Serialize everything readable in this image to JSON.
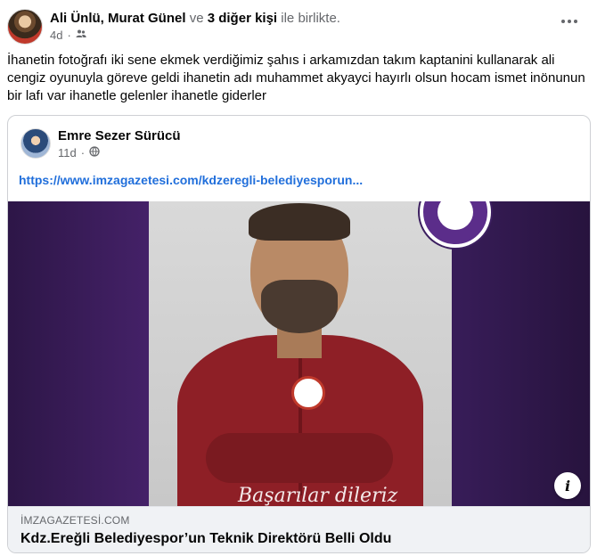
{
  "post": {
    "author1": "Ali Ünlü",
    "separator": ",",
    "author2": "Murat Günel",
    "and_word": "ve",
    "others": "3 diğer kişi",
    "with_text": "ile birlikte.",
    "time": "4d",
    "dot": "·",
    "audience_icon": "friends-icon",
    "body": "İhanetin fotoğrafı  iki sene ekmek verdiğimiz şahıs i arkamızdan takım kaptanini kullanarak ali cengiz oyunuyla göreve geldi ihanetin adı muhammet akyayci hayırlı olsun hocam  ismet inönunun bir lafı var ihanetle gelenler ihanetle giderler"
  },
  "shared": {
    "author": "Emre Sezer Sürücü",
    "time": "11d",
    "dot": "·",
    "audience_icon": "globe-icon",
    "link_text": "https://www.imzagazetesi.com/kdzeregli-belediyesporun...",
    "photo_caption": "Başarılar dileriz",
    "info_icon": "info-icon",
    "domain": "İMZAGAZETESİ.COM",
    "headline": "Kdz.Ereğli Belediyespor’un Teknik Direktörü Belli Oldu"
  },
  "colors": {
    "link_blue": "#216fdb",
    "muted": "#65676b",
    "jersey_red": "#8e1f26",
    "background_purple": "#4a2470"
  }
}
